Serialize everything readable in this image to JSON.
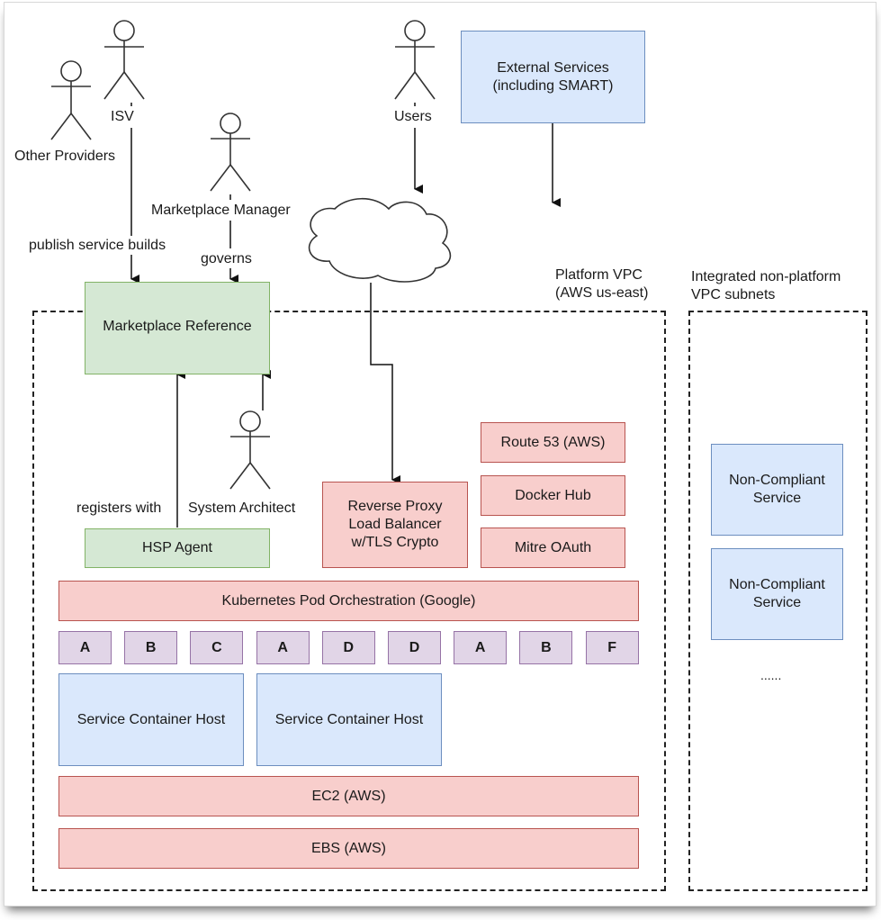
{
  "actors": {
    "other_providers": "Other Providers",
    "isv": "ISV",
    "marketplace_manager": "Marketplace Manager",
    "users": "Users",
    "system_architect": "System Architect"
  },
  "edge_labels": {
    "publish": "publish service builds",
    "governs": "governs",
    "registers": "registers with"
  },
  "external": {
    "line1": "External Services",
    "line2": "(including SMART)"
  },
  "regions": {
    "platform_vpc_line1": "Platform VPC",
    "platform_vpc_line2": "(AWS us-east)",
    "integrated_line1": "Integrated non-platform",
    "integrated_line2": "VPC subnets"
  },
  "components": {
    "marketplace_reference": "Marketplace Reference",
    "hsp_agent": "HSP Agent",
    "reverse_proxy_line1": "Reverse Proxy",
    "reverse_proxy_line2": "Load Balancer",
    "reverse_proxy_line3": "w/TLS Crypto",
    "route53": "Route 53 (AWS)",
    "docker_hub": "Docker Hub",
    "mitre_oauth": "Mitre OAuth",
    "kubernetes": "Kubernetes Pod Orchestration (Google)",
    "pods": [
      "A",
      "B",
      "C",
      "A",
      "D",
      "D",
      "A",
      "B",
      "F"
    ],
    "container_host_1": "Service Container Host",
    "container_host_2": "Service Container Host",
    "ec2": "EC2 (AWS)",
    "ebs": "EBS (AWS)"
  },
  "non_compliant": {
    "service_1_line1": "Non-Compliant",
    "service_1_line2": "Service",
    "service_2_line1": "Non-Compliant",
    "service_2_line2": "Service",
    "ellipsis": "......"
  }
}
